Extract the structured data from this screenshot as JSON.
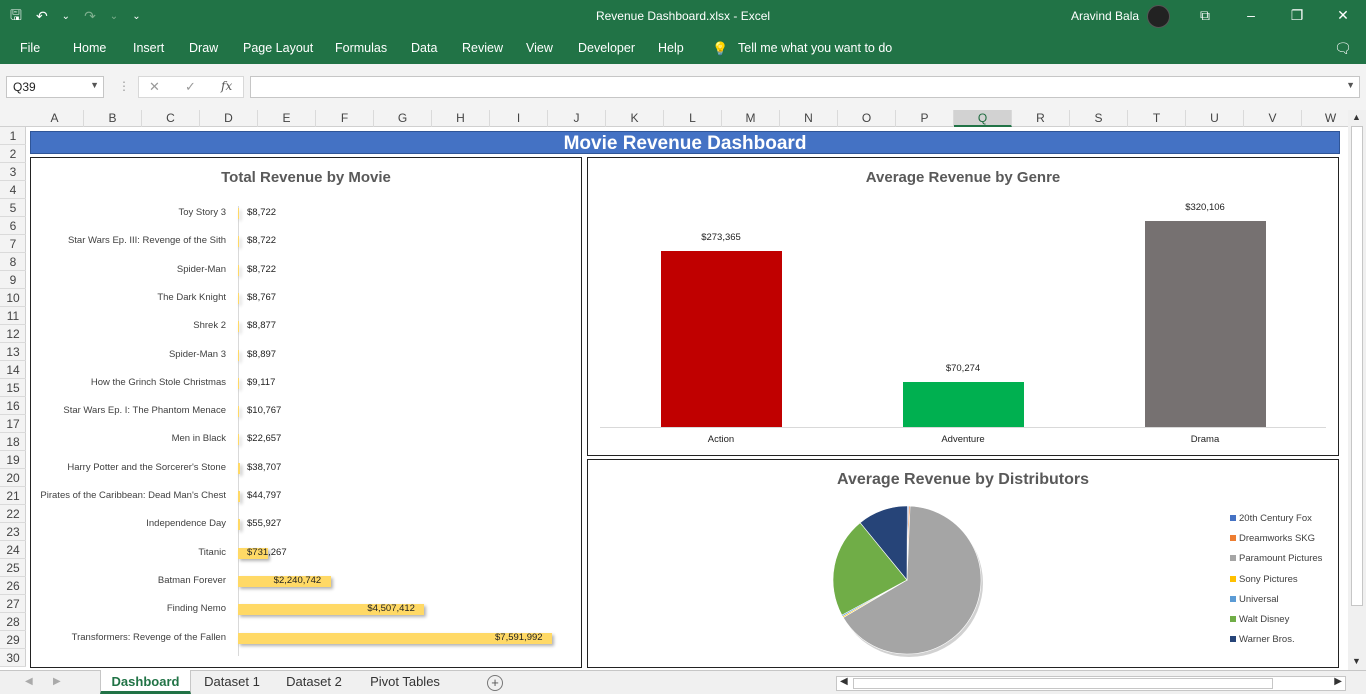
{
  "titlebar": {
    "doc_title": "Revenue Dashboard.xlsx  -  Excel",
    "user_name": "Aravind Bala",
    "minimize": "–",
    "restore": "❐",
    "close": "✕",
    "ribbon_display": "⧉"
  },
  "qat": {
    "save": "🖫",
    "undo": "↶",
    "undo_dd": "⌄",
    "redo": "↷",
    "redo_dd": "⌄",
    "customize": "⌄"
  },
  "ribbon": {
    "tabs": [
      "File",
      "Home",
      "Insert",
      "Draw",
      "Page Layout",
      "Formulas",
      "Data",
      "Review",
      "View",
      "Developer",
      "Help"
    ],
    "tell_me": "Tell me what you want to do",
    "tell_me_icon": "💡",
    "comment_icon": "🗨"
  },
  "formula_bar": {
    "name_box": "Q39",
    "cancel": "✕",
    "enter": "✓",
    "fx": "fx",
    "value": ""
  },
  "grid": {
    "columns": [
      "A",
      "B",
      "C",
      "D",
      "E",
      "F",
      "G",
      "H",
      "I",
      "J",
      "K",
      "L",
      "M",
      "N",
      "O",
      "P",
      "Q",
      "R",
      "S",
      "T",
      "U",
      "V",
      "W"
    ],
    "selected_column": "Q",
    "rows": [
      "1",
      "2",
      "3",
      "4",
      "5",
      "6",
      "7",
      "8",
      "9",
      "10",
      "11",
      "12",
      "13",
      "14",
      "15",
      "16",
      "17",
      "18",
      "19",
      "20",
      "21",
      "22",
      "23",
      "24",
      "25",
      "26",
      "27",
      "28",
      "29",
      "30"
    ]
  },
  "dashboard": {
    "banner": "Movie Revenue Dashboard"
  },
  "chart_data": [
    {
      "type": "bar",
      "orientation": "horizontal",
      "title": "Total Revenue by Movie",
      "categories": [
        "Toy Story 3",
        "Star Wars Ep. III: Revenge of the Sith",
        "Spider-Man",
        "The Dark Knight",
        "Shrek 2",
        "Spider-Man 3",
        "How the Grinch Stole Christmas",
        "Star Wars Ep. I: The Phantom Menace",
        "Men in Black",
        "Harry Potter and the Sorcerer's Stone",
        "Pirates of the Caribbean: Dead Man's Chest",
        "Independence Day",
        "Titanic",
        "Batman Forever",
        "Finding Nemo",
        "Transformers: Revenge of the Fallen"
      ],
      "values": [
        8722,
        8722,
        8722,
        8767,
        8877,
        8897,
        9117,
        10767,
        22657,
        38707,
        44797,
        55927,
        731267,
        2240742,
        4507412,
        7591992
      ],
      "value_labels": [
        "$8,722",
        "$8,722",
        "$8,722",
        "$8,767",
        "$8,877",
        "$8,897",
        "$9,117",
        "$10,767",
        "$22,657",
        "$38,707",
        "$44,797",
        "$55,927",
        "$731,267",
        "$2,240,742",
        "$4,507,412",
        "$7,591,992"
      ],
      "bar_color": "#ffd966"
    },
    {
      "type": "bar",
      "title": "Average Revenue by Genre",
      "categories": [
        "Action",
        "Adventure",
        "Drama"
      ],
      "values": [
        273365,
        70274,
        320106
      ],
      "value_labels": [
        "$273,365",
        "$70,274",
        "$320,106"
      ],
      "colors": [
        "#c00000",
        "#00b050",
        "#767171"
      ]
    },
    {
      "type": "pie",
      "title": "Average Revenue by Distributors",
      "legend_position": "right",
      "labels": [
        "20th Century Fox",
        "Dreamworks SKG",
        "Paramount Pictures",
        "Sony Pictures",
        "Universal",
        "Walt Disney",
        "Warner Bros."
      ],
      "values": [
        0.3,
        0.3,
        66,
        0.3,
        0.3,
        22,
        11
      ],
      "colors": [
        "#4472c4",
        "#ed7d31",
        "#a5a5a5",
        "#ffc000",
        "#5b9bd5",
        "#70ad47",
        "#264478"
      ]
    }
  ],
  "sheet_tabs": {
    "tabs": [
      "Dashboard",
      "Dataset 1",
      "Dataset 2",
      "Pivot Tables"
    ],
    "active": "Dashboard",
    "add": "+"
  }
}
